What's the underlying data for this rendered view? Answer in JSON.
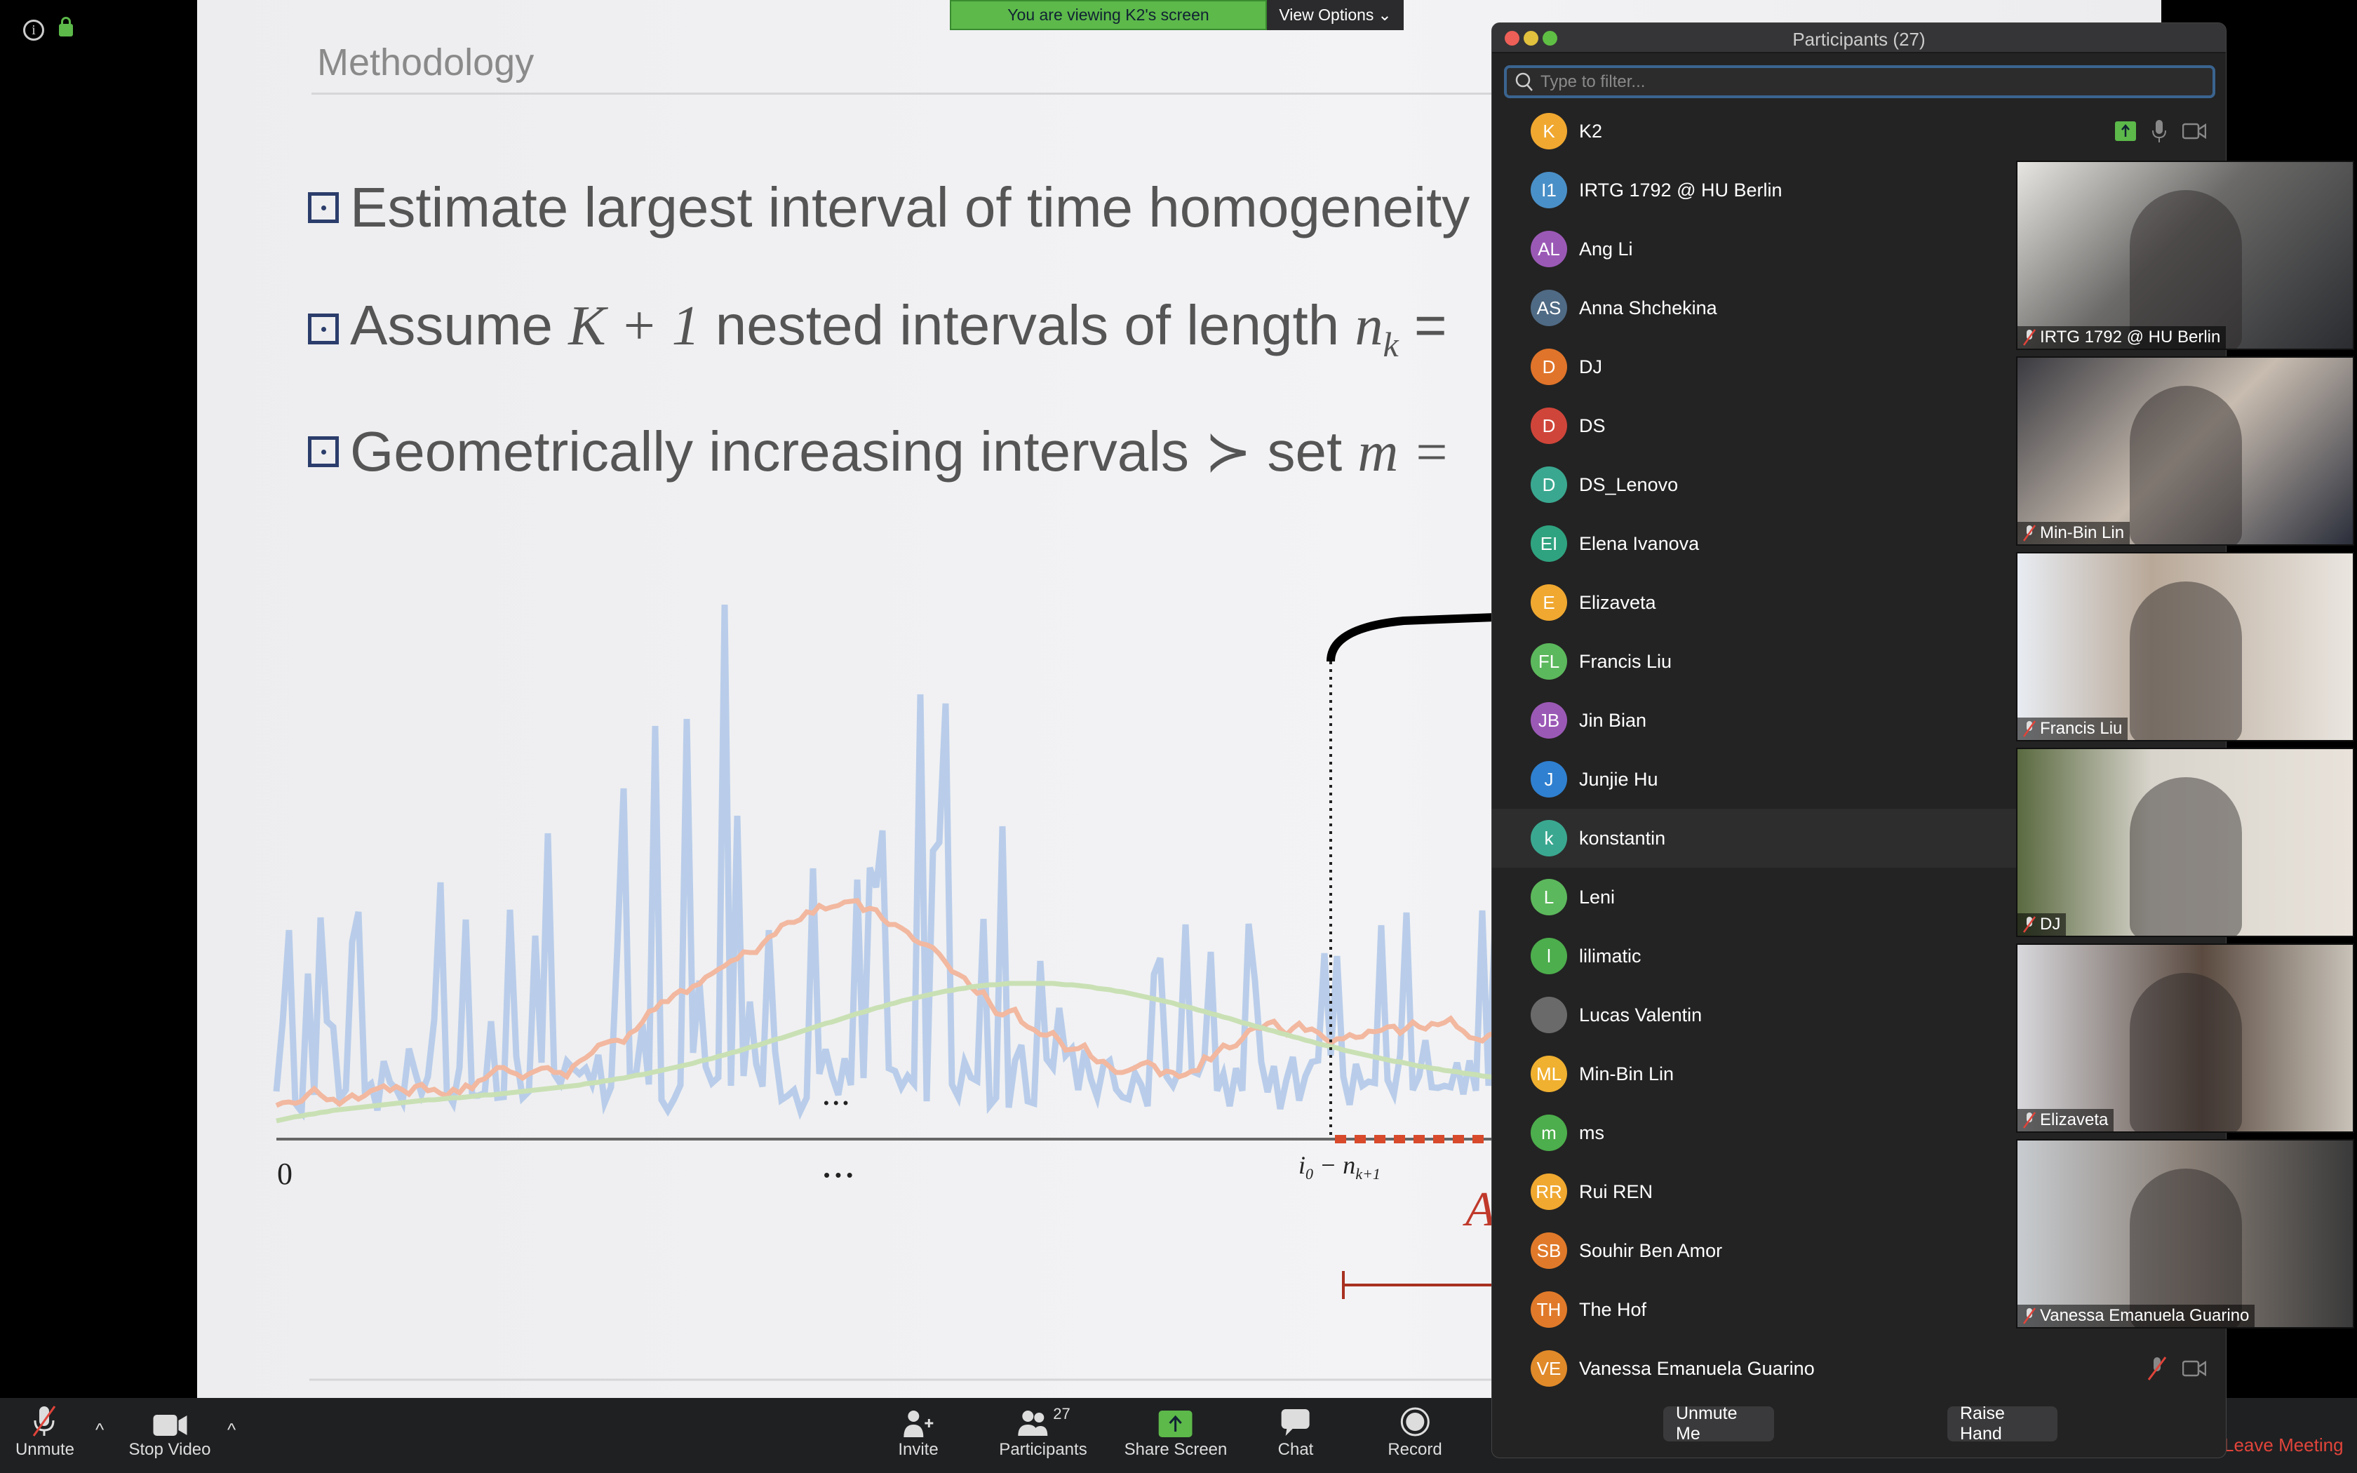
{
  "banner": {
    "text": "You are viewing K2's screen",
    "view_options": "View Options"
  },
  "slide": {
    "title": "Methodology",
    "bullet1": "Estimate largest interval of time homogeneity",
    "bullet2_pre": "Assume ",
    "bullet2_math": "K + 1",
    "bullet2_mid": " nested intervals of length ",
    "bullet2_var": "n",
    "bullet2_sub": "k",
    "bullet2_end": " =",
    "bullet3_pre": "Geometrically increasing intervals ≻ set ",
    "bullet3_math": "m = ",
    "axis_zero": "0",
    "dots": "• • •",
    "interval_label": "i",
    "interval_sub0": "0",
    "interval_minus": " − n",
    "interval_sub": "k+1",
    "red_label": "A"
  },
  "panel": {
    "title": "Participants (27)",
    "search_placeholder": "Type to filter...",
    "participants": [
      {
        "initials": "K",
        "name": "K2",
        "color": "#f0a830"
      },
      {
        "initials": "I1",
        "name": "IRTG 1792 @ HU Berlin",
        "color": "#4a90c8"
      },
      {
        "initials": "AL",
        "name": "Ang Li",
        "color": "#9b59b6"
      },
      {
        "initials": "AS",
        "name": "Anna Shchekina",
        "color": "#4f6a84"
      },
      {
        "initials": "D",
        "name": "DJ",
        "color": "#e0742a"
      },
      {
        "initials": "D",
        "name": "DS",
        "color": "#d0453a"
      },
      {
        "initials": "D",
        "name": "DS_Lenovo",
        "color": "#3aa890"
      },
      {
        "initials": "EI",
        "name": "Elena Ivanova",
        "color": "#2fa37f"
      },
      {
        "initials": "E",
        "name": "Elizaveta",
        "color": "#f0a830"
      },
      {
        "initials": "FL",
        "name": "Francis Liu",
        "color": "#5cb85c"
      },
      {
        "initials": "JB",
        "name": "Jin Bian",
        "color": "#9b59b6"
      },
      {
        "initials": "J",
        "name": "Junjie Hu",
        "color": "#2f80d0"
      },
      {
        "initials": "k",
        "name": "konstantin",
        "color": "#3aa890"
      },
      {
        "initials": "L",
        "name": "Leni",
        "color": "#5cb85c"
      },
      {
        "initials": "l",
        "name": "lilimatic",
        "color": "#4cae4c"
      },
      {
        "initials": "",
        "name": "Lucas Valentin",
        "color": "#6a6a6a"
      },
      {
        "initials": "ML",
        "name": "Min-Bin Lin",
        "color": "#f0b030"
      },
      {
        "initials": "m",
        "name": "ms",
        "color": "#4cae4c"
      },
      {
        "initials": "RR",
        "name": "Rui REN",
        "color": "#f0a830"
      },
      {
        "initials": "SB",
        "name": "Souhir Ben Amor",
        "color": "#e07a2a"
      },
      {
        "initials": "TH",
        "name": "The Hof",
        "color": "#e07a2a"
      },
      {
        "initials": "VE",
        "name": "Vanessa Emanuela Guarino",
        "color": "#e08a2a"
      }
    ],
    "unmute_me": "Unmute Me",
    "raise_hand": "Raise Hand"
  },
  "videos": [
    "IRTG 1792 @ HU Berlin",
    "Min-Bin Lin",
    "Francis Liu",
    "DJ",
    "Elizaveta",
    "Vanessa Emanuela Guarino"
  ],
  "toolbar": {
    "unmute": "Unmute",
    "stop_video": "Stop Video",
    "invite": "Invite",
    "participants": "Participants",
    "participants_count": "27",
    "share_screen": "Share Screen",
    "chat": "Chat",
    "record": "Record",
    "leave": "Leave Meeting"
  },
  "colors": {
    "share_green": "#5cb94a",
    "leave_red": "#e0443a",
    "search_border": "#3a6490"
  }
}
